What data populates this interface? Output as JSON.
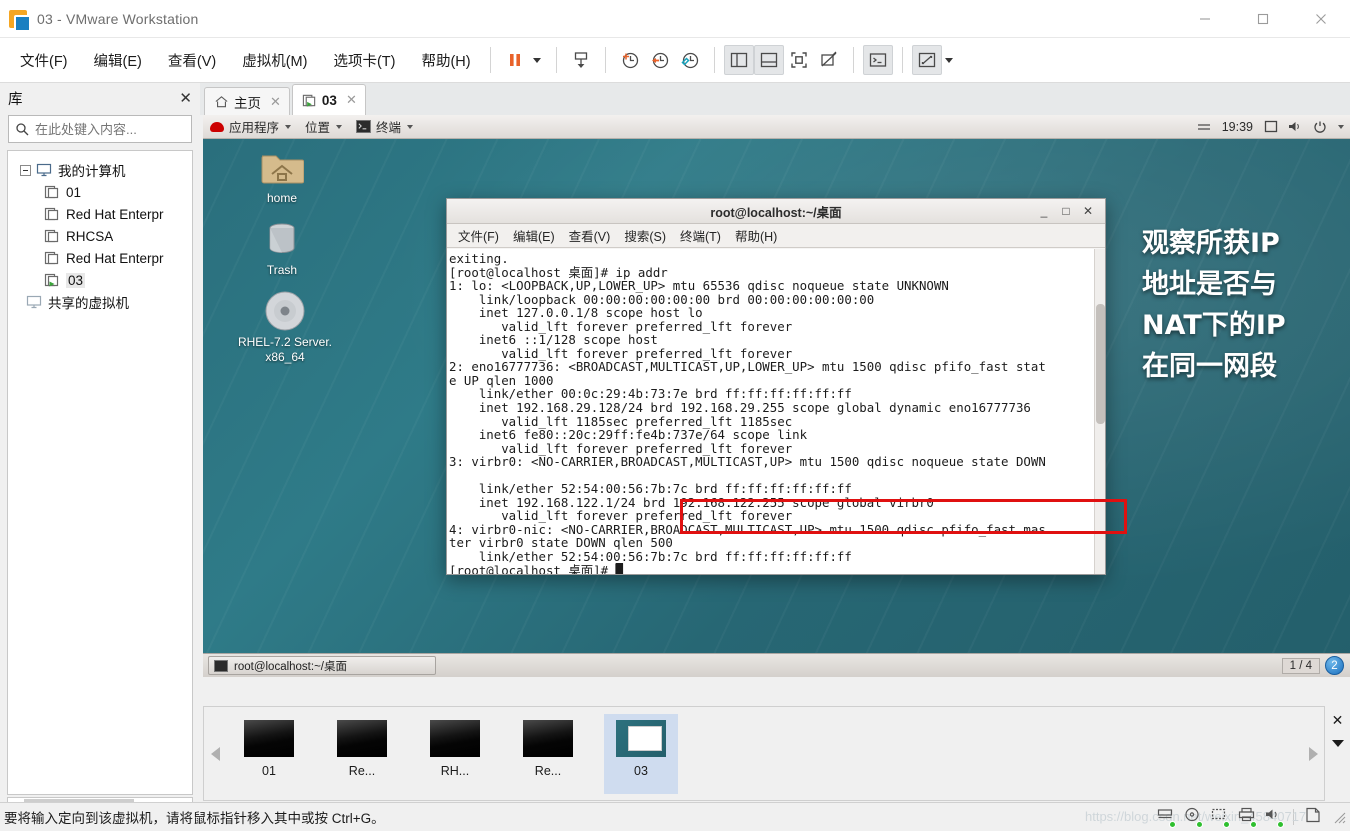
{
  "window": {
    "title": "03 - VMware Workstation",
    "controls": {
      "minimize": "minimize-icon",
      "maximize": "maximize-icon",
      "close": "close-icon"
    }
  },
  "menubar": {
    "items": [
      {
        "label": "文件(F)",
        "key": "F"
      },
      {
        "label": "编辑(E)",
        "key": "E"
      },
      {
        "label": "查看(V)",
        "key": "V"
      },
      {
        "label": "虚拟机(M)",
        "key": "M"
      },
      {
        "label": "选项卡(T)",
        "key": "T"
      },
      {
        "label": "帮助(H)",
        "key": "H"
      }
    ]
  },
  "toolbar": {
    "buttons": [
      {
        "name": "pause-icon"
      },
      {
        "name": "dropdown-caret-icon"
      },
      {
        "name": "snapshot-take-icon"
      },
      {
        "name": "snapshot-clock-icon"
      },
      {
        "name": "snapshot-revert-icon"
      },
      {
        "name": "snapshot-manager-icon"
      },
      {
        "name": "show-library-icon"
      },
      {
        "name": "show-thumbnails-icon"
      },
      {
        "name": "full-screen-icon"
      },
      {
        "name": "unity-mode-icon"
      },
      {
        "name": "console-icon"
      },
      {
        "name": "stretch-icon"
      }
    ]
  },
  "sidebar": {
    "title": "库",
    "close_label": "✕",
    "search": {
      "placeholder": "在此处键入内容...",
      "value": "",
      "icon": "search-icon"
    },
    "tree": {
      "root": {
        "label": "我的计算机",
        "icon": "computer-icon"
      },
      "children": [
        {
          "label": "01",
          "icon": "vm-icon",
          "running": false
        },
        {
          "label": "Red Hat Enterpr",
          "icon": "vm-icon",
          "running": false
        },
        {
          "label": "RHCSA",
          "icon": "vm-icon",
          "running": false
        },
        {
          "label": "Red Hat Enterpr",
          "icon": "vm-icon",
          "running": false
        },
        {
          "label": "03",
          "icon": "vm-running-icon",
          "running": true
        }
      ],
      "shared": {
        "label": "共享的虚拟机",
        "icon": "shared-vm-icon"
      }
    },
    "hscroll": {
      "left": "‹",
      "right": "›"
    }
  },
  "tabs": [
    {
      "label": "主页",
      "icon": "home-icon",
      "active": false,
      "close": "✕"
    },
    {
      "label": "03",
      "icon": "vm-running-icon",
      "active": true,
      "close": "✕"
    }
  ],
  "guest": {
    "panel": {
      "applications": "应用程序",
      "places": "位置",
      "terminal": "终端",
      "clock": "19:39",
      "right_icons": [
        "network-icon",
        "display-icon",
        "volume-icon",
        "power-icon",
        "caret-down-icon"
      ]
    },
    "desktop_icons": [
      {
        "label": "home",
        "icon": "home-folder-icon"
      },
      {
        "label": "Trash",
        "icon": "trash-icon"
      },
      {
        "label": "RHEL-7.2 Server.\nx86_64",
        "icon": "optical-disc-icon"
      }
    ],
    "annotation": [
      "观察所获IP",
      "地址是否与",
      "NAT下的IP",
      "在同一网段"
    ],
    "terminal": {
      "title": "root@localhost:~/桌面",
      "window_buttons": {
        "minimize": "_",
        "maximize": "□",
        "close": "✕"
      },
      "menu": [
        "文件(F)",
        "编辑(E)",
        "查看(V)",
        "搜索(S)",
        "终端(T)",
        "帮助(H)"
      ],
      "lines": [
        "exiting.",
        "[root@localhost 桌面]# ip addr",
        "1: lo: <LOOPBACK,UP,LOWER_UP> mtu 65536 qdisc noqueue state UNKNOWN",
        "    link/loopback 00:00:00:00:00:00 brd 00:00:00:00:00:00",
        "    inet 127.0.0.1/8 scope host lo",
        "       valid_lft forever preferred_lft forever",
        "    inet6 ::1/128 scope host",
        "       valid_lft forever preferred_lft forever",
        "2: eno16777736: <BROADCAST,MULTICAST,UP,LOWER_UP> mtu 1500 qdisc pfifo_fast stat",
        "e UP qlen 1000",
        "    link/ether 00:0c:29:4b:73:7e brd ff:ff:ff:ff:ff:ff",
        "    inet 192.168.29.128/24 brd 192.168.29.255 scope global dynamic eno16777736",
        "       valid_lft 1185sec preferred_lft 1185sec",
        "    inet6 fe80::20c:29ff:fe4b:737e/64 scope link",
        "       valid_lft forever preferred_lft forever",
        "3: virbr0: <NO-CARRIER,BROADCAST,MULTICAST,UP> mtu 1500 qdisc noqueue state DOWN",
        "",
        "    link/ether 52:54:00:56:7b:7c brd ff:ff:ff:ff:ff:ff",
        "    inet 192.168.122.1/24 brd 192.168.122.255 scope global virbr0",
        "       valid_lft forever preferred_lft forever",
        "4: virbr0-nic: <NO-CARRIER,BROADCAST,MULTICAST,UP> mtu 1500 qdisc pfifo_fast mas",
        "ter virbr0 state DOWN qlen 500",
        "    link/ether 52:54:00:56:7b:7c brd ff:ff:ff:ff:ff:ff",
        "[root@localhost 桌面]# "
      ],
      "highlight_color": "#e01010"
    },
    "taskbar": {
      "task_label": "root@localhost:~/桌面",
      "workspace_indicator": "1 / 4",
      "workspace_badge": "2"
    }
  },
  "thumbnails": [
    {
      "label": "01",
      "selected": false,
      "live": false
    },
    {
      "label": "Re...",
      "selected": false,
      "live": false
    },
    {
      "label": "RH...",
      "selected": false,
      "live": false
    },
    {
      "label": "Re...",
      "selected": false,
      "live": false
    },
    {
      "label": "03",
      "selected": true,
      "live": true
    }
  ],
  "thumbstrip": {
    "close": "✕",
    "scroll_left": "left-arrow-icon",
    "scroll_right": "right-arrow-icon"
  },
  "statusbar": {
    "message": "要将输入定向到该虚拟机，请将鼠标指针移入其中或按 Ctrl+G。",
    "watermark": "https://blog.csdn.net/weixin_45840717",
    "device_icons": [
      "hard-disk-icon",
      "cd-drive-icon",
      "network-adapter-icon",
      "printer-icon",
      "sound-card-icon",
      "detach-icon"
    ]
  },
  "colors": {
    "accent": "#1a7fc1",
    "vmware_orange": "#f5a623",
    "highlight_red": "#e01010",
    "desktop_teal": "#2a6e7c",
    "selected_thumb": "#cfdcef"
  }
}
